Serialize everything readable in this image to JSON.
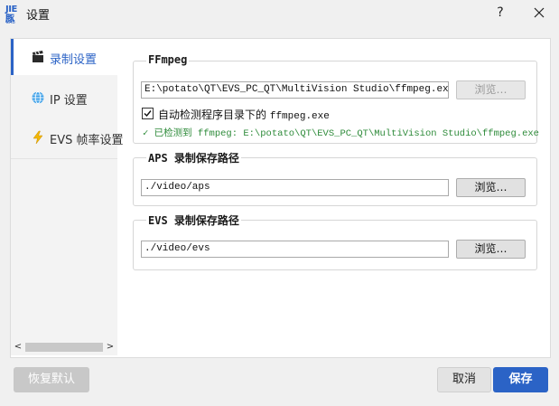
{
  "window": {
    "logo_text": "JIE豚",
    "logo_sub": "JIE LAB",
    "title": "设置",
    "help": "?"
  },
  "sidebar": {
    "items": [
      {
        "label": "录制设置",
        "icon": "clapperboard-icon",
        "active": true
      },
      {
        "label": "IP 设置",
        "icon": "globe-icon",
        "active": false
      },
      {
        "label": "EVS 帧率设置",
        "icon": "lightning-icon",
        "active": false
      }
    ],
    "scroll_left": "<",
    "scroll_right": ">"
  },
  "ffmpeg": {
    "title": "FFmpeg",
    "path": "E:\\potato\\QT\\EVS_PC_QT\\MultiVision Studio\\ffmpeg.exe",
    "browse_label": "浏览…",
    "browse_enabled": false,
    "auto_detect_label": "自动检测程序目录下的",
    "auto_detect_file": "ffmpeg.exe",
    "auto_detect_checked": true,
    "detected_text": "✓ 已检测到 ffmpeg: E:\\potato\\QT\\EVS_PC_QT\\MultiVision Studio\\ffmpeg.exe"
  },
  "aps": {
    "title": "APS 录制保存路径",
    "path": "./video/aps",
    "browse_label": "浏览…"
  },
  "evs": {
    "title": "EVS 录制保存路径",
    "path": "./video/evs",
    "browse_label": "浏览…"
  },
  "footer": {
    "reset_label": "恢复默认",
    "cancel_label": "取消",
    "save_label": "保存"
  },
  "colors": {
    "accent": "#2b63c6",
    "success": "#2e8b3a",
    "disabled_button": "#c8c8c8"
  }
}
